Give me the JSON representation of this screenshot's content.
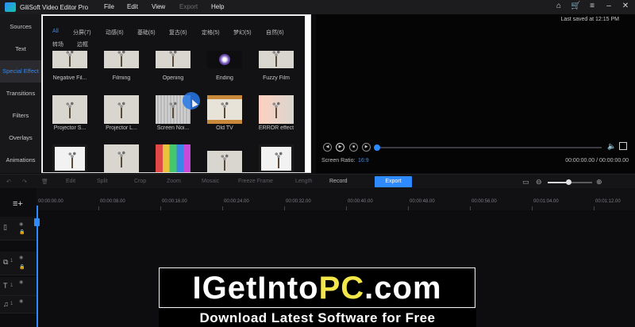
{
  "app": {
    "title": "GiliSoft Video Editor Pro",
    "menu": [
      "File",
      "Edit",
      "View",
      "Export",
      "Help"
    ],
    "window_controls": [
      "home-icon",
      "cart-icon",
      "menu-icon",
      "minimize-icon",
      "close-icon"
    ]
  },
  "nav": {
    "items": [
      "Sources",
      "Text",
      "Special Effect",
      "Transitions",
      "Filters",
      "Overlays",
      "Animations"
    ],
    "active": "Special Effect"
  },
  "effects": {
    "tabs": [
      "All",
      "分屏(7)",
      "动感(6)",
      "基础(6)",
      "复古(6)",
      "定格(5)",
      "梦幻(5)",
      "自然(6)",
      "转场",
      "边框"
    ],
    "active_tab": "All",
    "rows": [
      [
        "Negative Fil...",
        "Filming",
        "Opening",
        "Ending",
        "Fuzzy Film"
      ],
      [
        "Projector S...",
        "Projector L...",
        "Screen Noi...",
        "Old TV",
        "ERROR effect"
      ]
    ]
  },
  "preview": {
    "last_saved": "Last saved at 12:15 PM",
    "screen_ratio_label": "Screen Ratio:",
    "screen_ratio_value": "16:9",
    "timecode": "00:00:00.00 / 00:00:00.00"
  },
  "toolbar": {
    "tools": [
      "Edit",
      "Split",
      "Crop",
      "Zoom",
      "Mosaic",
      "Freeze Frame",
      "Length",
      "Record"
    ],
    "export_label": "Export"
  },
  "timeline": {
    "ticks": [
      "00:00:00.00",
      "00:00:08.00",
      "00:00:16.00",
      "00:00:24.00",
      "00:00:32.00",
      "00:00:40.00",
      "00:00:48.00",
      "00:00:56.00",
      "00:01:04.00",
      "00:01:12.00"
    ],
    "track_numbers": [
      "1",
      "1",
      "1"
    ]
  },
  "watermark": {
    "title_a": "IGetInto",
    "title_b": "PC",
    "title_c": ".com",
    "subtitle": "Download Latest Software for Free"
  }
}
